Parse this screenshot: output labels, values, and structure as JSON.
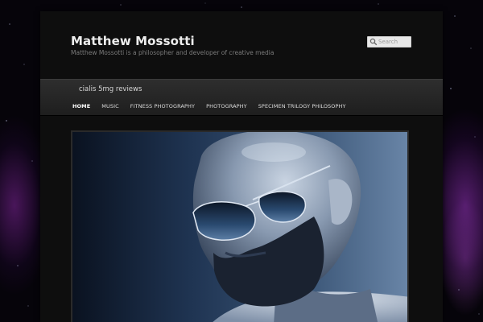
{
  "site": {
    "title": "Matthew Mossotti",
    "description": "Matthew Mossotti is a philosopher and developer of creative media"
  },
  "search": {
    "placeholder": "Search",
    "icon": "search-icon"
  },
  "nav": {
    "sub_link": "cialis 5mg reviews",
    "menu": [
      {
        "label": "HOME",
        "active": true
      },
      {
        "label": "MUSIC",
        "active": false
      },
      {
        "label": "FITNESS PHOTOGRAPHY",
        "active": false
      },
      {
        "label": "PHOTOGRAPHY",
        "active": false
      },
      {
        "label": "SPECIMEN TRILOGY PHILOSOPHY",
        "active": false
      }
    ]
  },
  "colors": {
    "background": "#06040a",
    "nebula": "#9632be",
    "page": "#0e0e0e",
    "nav": "#2a2a2a",
    "photo_tint": "#5a7498"
  }
}
